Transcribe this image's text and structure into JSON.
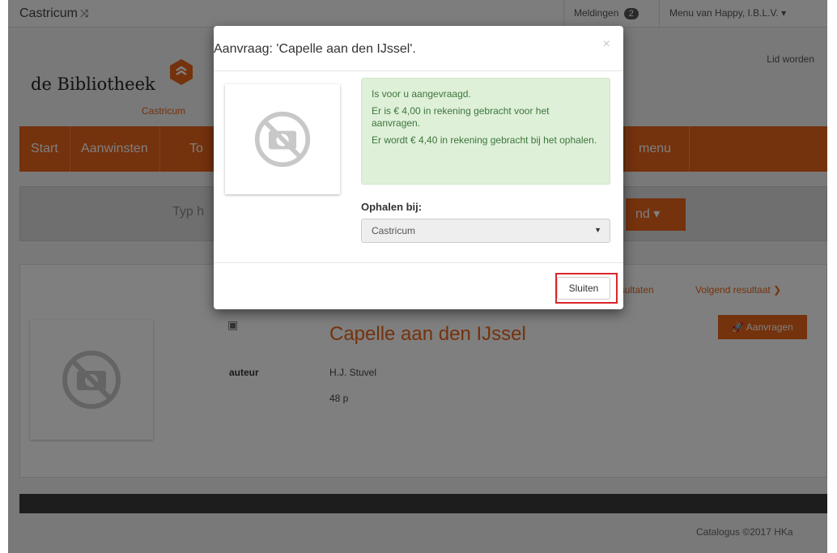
{
  "topbar": {
    "brand": "Castricum",
    "notifications_label": "Meldingen",
    "notifications_count": "2",
    "user_menu": "Menu van Happy, I.B.L.V. ▾"
  },
  "logo": {
    "name": "de Bibliotheek",
    "sub": "Castricum"
  },
  "lid_worden": "Lid worden",
  "nav": {
    "items": [
      "Start",
      "Aanwinsten",
      "To",
      "menu"
    ]
  },
  "search": {
    "placeholder": "Typ h",
    "button": "nd  ▾"
  },
  "result": {
    "results_link": "resultaten",
    "next_link": "Volgend resultaat ❯",
    "request_button": "Aanvragen",
    "title": "Capelle aan den IJssel",
    "author_label": "auteur",
    "author": "H.J. Stuvel",
    "pages": "48 p"
  },
  "footer": {
    "copyright": "Catalogus ©2017 HKa"
  },
  "modal": {
    "title": "Aanvraag: 'Capelle aan den IJssel'.",
    "close": "×",
    "alert_lines": [
      "Is voor u aangevraagd.",
      "Er is € 4,00 in rekening gebracht voor het aanvragen.",
      "Er wordt € 4,40 in rekening gebracht bij het ophalen."
    ],
    "pickup_label": "Ophalen bij:",
    "pickup_value": "Castricum",
    "close_button": "Sluiten"
  },
  "colors": {
    "accent": "#e8641b",
    "alert_bg": "#dff0d8",
    "alert_text": "#3c763d",
    "highlight": "#d9262b"
  }
}
